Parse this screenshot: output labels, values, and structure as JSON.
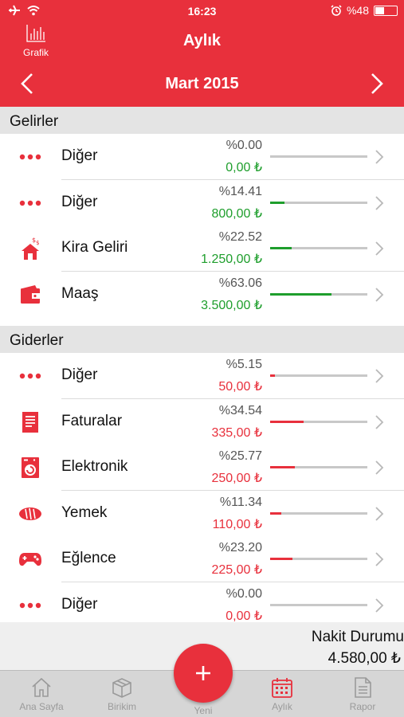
{
  "status_bar": {
    "time": "16:23",
    "battery": "%48",
    "battery_level": 0.48
  },
  "nav": {
    "title": "Aylık",
    "grafik_label": "Grafik"
  },
  "month": {
    "title": "Mart 2015"
  },
  "income": {
    "header": "Gelirler",
    "rows": [
      {
        "name": "Diğer",
        "percent": "%0.00",
        "amount": "0,00 ₺",
        "fraction": 0.0,
        "icon": "dots-icon"
      },
      {
        "name": "Diğer",
        "percent": "%14.41",
        "amount": "800,00 ₺",
        "fraction": 0.1441,
        "icon": "dots-icon"
      },
      {
        "name": "Kira Geliri",
        "percent": "%22.52",
        "amount": "1.250,00 ₺",
        "fraction": 0.2252,
        "icon": "house-money-icon"
      },
      {
        "name": "Maaş",
        "percent": "%63.06",
        "amount": "3.500,00 ₺",
        "fraction": 0.6306,
        "icon": "wallet-icon"
      }
    ]
  },
  "expense": {
    "header": "Giderler",
    "rows": [
      {
        "name": "Diğer",
        "percent": "%5.15",
        "amount": "50,00 ₺",
        "fraction": 0.0515,
        "icon": "dots-icon"
      },
      {
        "name": "Faturalar",
        "percent": "%34.54",
        "amount": "335,00 ₺",
        "fraction": 0.3454,
        "icon": "bill-icon"
      },
      {
        "name": "Elektronik",
        "percent": "%25.77",
        "amount": "250,00 ₺",
        "fraction": 0.2577,
        "icon": "washing-machine-icon"
      },
      {
        "name": "Yemek",
        "percent": "%11.34",
        "amount": "110,00 ₺",
        "fraction": 0.1134,
        "icon": "bread-icon"
      },
      {
        "name": "Eğlence",
        "percent": "%23.20",
        "amount": "225,00 ₺",
        "fraction": 0.232,
        "icon": "gamepad-icon"
      },
      {
        "name": "Diğer",
        "percent": "%0.00",
        "amount": "0,00 ₺",
        "fraction": 0.0,
        "icon": "dots-icon"
      }
    ]
  },
  "summary": {
    "label": "Nakit Durumu",
    "value": "4.580,00 ₺"
  },
  "tabs": [
    {
      "label": "Ana Sayfa",
      "icon": "home-icon"
    },
    {
      "label": "Birikim",
      "icon": "box-icon"
    },
    {
      "label": "Yeni",
      "icon": "plus-icon"
    },
    {
      "label": "Aylık",
      "icon": "calendar-icon"
    },
    {
      "label": "Rapor",
      "icon": "report-icon"
    }
  ],
  "colors": {
    "brand": "#e8303c",
    "income": "#1e9e2c",
    "expense": "#e8303c"
  }
}
